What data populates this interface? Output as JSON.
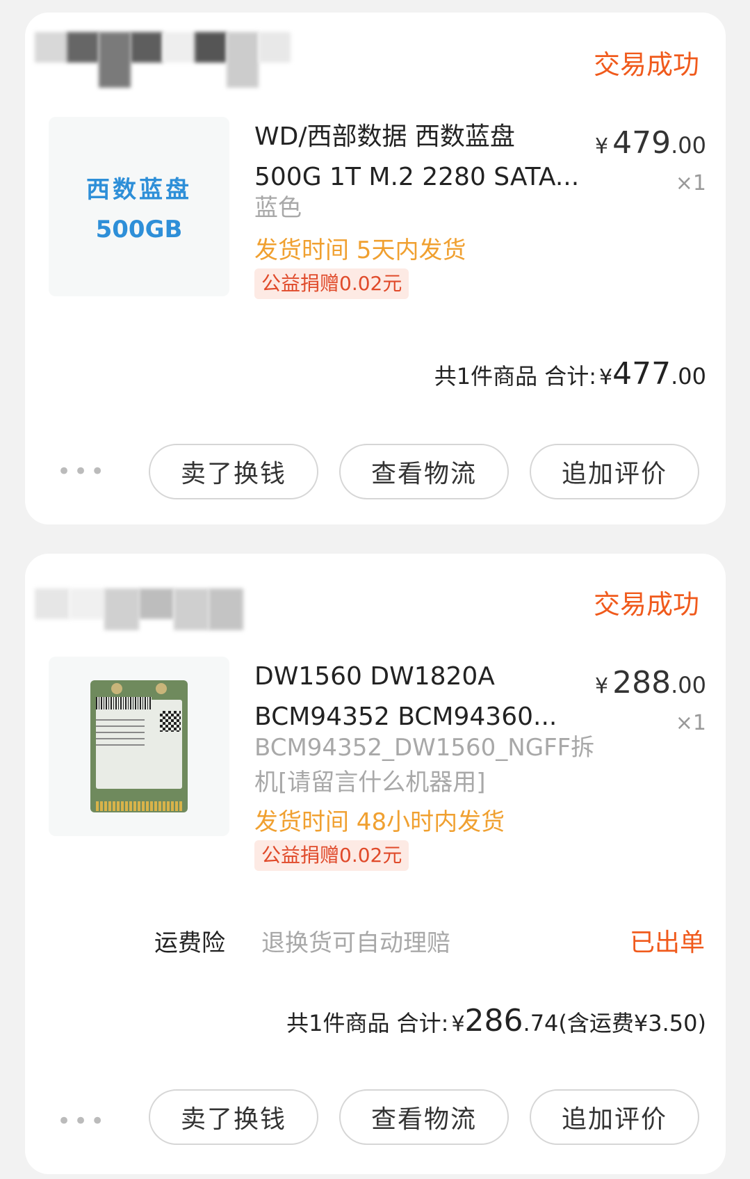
{
  "orders": [
    {
      "status": "交易成功",
      "thumb_line1": "西数蓝盘",
      "thumb_line2": "500GB",
      "title_line1": "WD/西部数据 西数蓝盘",
      "title_line2": "500G 1T M.2 2280 SATA...",
      "sku": "蓝色",
      "ship_time": "发货时间 5天内发货",
      "charity": "公益捐赠0.02元",
      "price_yen": "¥",
      "price_int": "479",
      "price_dec": ".00",
      "qty": "×1",
      "total_label": "共1件商品  合计:",
      "total_yen": "¥",
      "total_int": "477",
      "total_dec": ".00",
      "more": "•••",
      "buttons": [
        "卖了换钱",
        "查看物流",
        "追加评价"
      ]
    },
    {
      "status": "交易成功",
      "title_line1": "DW1560 DW1820A",
      "title_line2": "BCM94352 BCM94360...",
      "sku_line1": "BCM94352_DW1560_NGFF拆",
      "sku_line2": "机[请留言什么机器用]",
      "ship_time": "发货时间 48小时内发货",
      "charity": "公益捐赠0.02元",
      "price_yen": "¥",
      "price_int": "288",
      "price_dec": ".00",
      "qty": "×1",
      "insurance_label": "运费险",
      "insurance_desc": "退换货可自动理赔",
      "insurance_status": "已出单",
      "total_label": "共1件商品  合计:",
      "total_yen": "¥",
      "total_int": "286",
      "total_dec": ".74",
      "total_extra": "(含运费¥3.50)",
      "more": "•••",
      "buttons": [
        "卖了换钱",
        "查看物流",
        "追加评价"
      ]
    }
  ],
  "colors": {
    "status": "#f05a1c",
    "ship_time": "#f0a030",
    "charity_text": "#e04a2a",
    "charity_bg": "#fdeae4"
  }
}
